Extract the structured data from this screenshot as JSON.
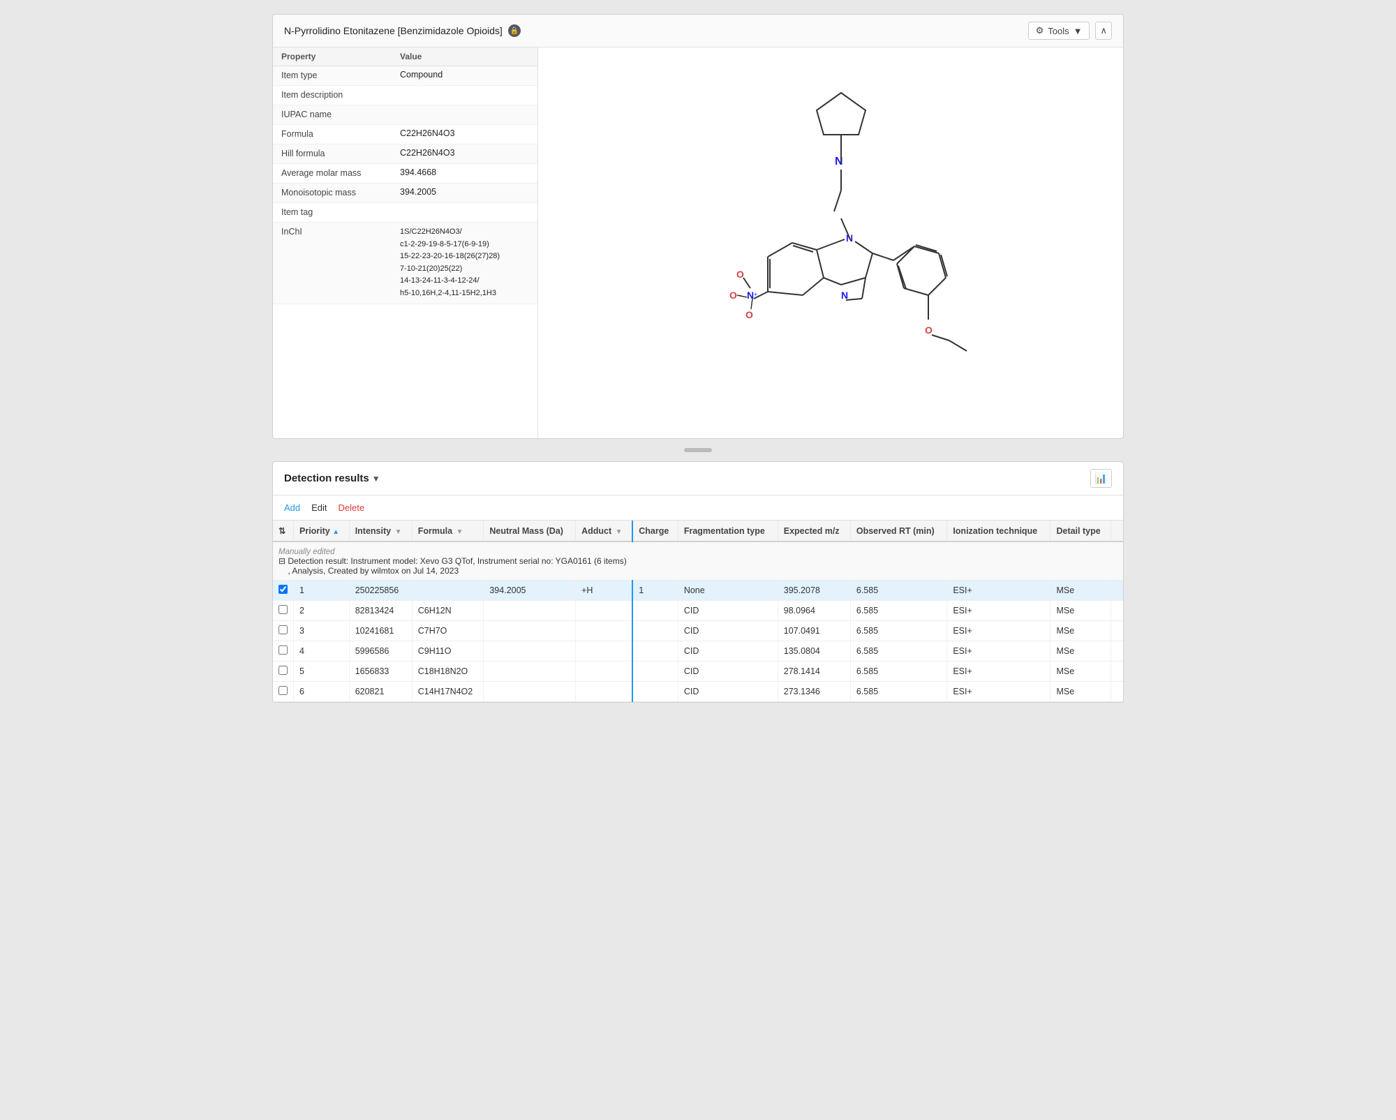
{
  "topPanel": {
    "title": "N-Pyrrolidino Etonitazene  [Benzimidazole Opioids]",
    "toolsLabel": "Tools",
    "properties": [
      {
        "label": "Property",
        "value": "Value",
        "isHeader": true
      },
      {
        "label": "Item type",
        "value": "Compound"
      },
      {
        "label": "Item description",
        "value": ""
      },
      {
        "label": "IUPAC name",
        "value": ""
      },
      {
        "label": "Formula",
        "value": "C22H26N4O3"
      },
      {
        "label": "Hill formula",
        "value": "C22H26N4O3"
      },
      {
        "label": "Average molar mass",
        "value": "394.4668"
      },
      {
        "label": "Monoisotopic mass",
        "value": "394.2005"
      },
      {
        "label": "Item tag",
        "value": ""
      },
      {
        "label": "InChI",
        "value": "1S/C22H26N4O3/\nc1-2-29-19-8-5-17(6-9-19)\n15-22-23-20-16-18(26(27)28)\n7-10-21(20)25(22)\n14-13-24-11-3-4-12-24/\nh5-10,16H,2-4,11-15H2,1H3"
      }
    ]
  },
  "bottomPanel": {
    "title": "Detection results",
    "dropdownArrow": "▼",
    "toolbar": {
      "add": "Add",
      "edit": "Edit",
      "delete": "Delete"
    },
    "tableHeaders": [
      {
        "label": "",
        "key": "cb"
      },
      {
        "label": "Priority",
        "key": "priority",
        "sortable": true,
        "sort": "asc"
      },
      {
        "label": "Intensity",
        "key": "intensity",
        "sortable": true
      },
      {
        "label": "Formula",
        "key": "formula",
        "sortable": true
      },
      {
        "label": "Neutral Mass (Da)",
        "key": "neutralMass",
        "sortable": true
      },
      {
        "label": "Adduct",
        "key": "adduct",
        "sortable": true
      },
      {
        "label": "Charge",
        "key": "charge",
        "sortable": false,
        "divider": true
      },
      {
        "label": "Fragmentation type",
        "key": "fragmentationType",
        "sortable": false
      },
      {
        "label": "Expected m/z",
        "key": "expectedMz",
        "sortable": false
      },
      {
        "label": "Observed RT (min)",
        "key": "observedRT",
        "sortable": false
      },
      {
        "label": "Ionization technique",
        "key": "ionizationTechnique",
        "sortable": false
      },
      {
        "label": "Detail type",
        "key": "detailType",
        "sortable": false
      }
    ],
    "detectionResultLabel": "Detection result: Instrument model: Xevo G3 QTof, Instrument serial no: YGA0161 (6 items)\n, Analysis, Created by wilmtox on Jul 14, 2023",
    "manuallyEditedLabel": "Manually edited",
    "rows": [
      {
        "num": 1,
        "priority": 1,
        "intensity": 250225856,
        "formula": "",
        "neutralMass": "394.2005",
        "adduct": "+H",
        "charge": "1",
        "fragmentationType": "None",
        "expectedMz": "395.2078",
        "observedRT": "6.585",
        "ionizationTechnique": "ESI+",
        "detailType": "MSe",
        "selected": true
      },
      {
        "num": 2,
        "priority": 2,
        "intensity": 82813424,
        "formula": "C6H12N",
        "neutralMass": "",
        "adduct": "",
        "charge": "",
        "fragmentationType": "CID",
        "expectedMz": "98.0964",
        "observedRT": "6.585",
        "ionizationTechnique": "ESI+",
        "detailType": "MSe",
        "selected": false
      },
      {
        "num": 3,
        "priority": 3,
        "intensity": 10241681,
        "formula": "C7H7O",
        "neutralMass": "",
        "adduct": "",
        "charge": "",
        "fragmentationType": "CID",
        "expectedMz": "107.0491",
        "observedRT": "6.585",
        "ionizationTechnique": "ESI+",
        "detailType": "MSe",
        "selected": false
      },
      {
        "num": 4,
        "priority": 4,
        "intensity": 5996586,
        "formula": "C9H11O",
        "neutralMass": "",
        "adduct": "",
        "charge": "",
        "fragmentationType": "CID",
        "expectedMz": "135.0804",
        "observedRT": "6.585",
        "ionizationTechnique": "ESI+",
        "detailType": "MSe",
        "selected": false
      },
      {
        "num": 5,
        "priority": 5,
        "intensity": 1656833,
        "formula": "C18H18N2O",
        "neutralMass": "",
        "adduct": "",
        "charge": "",
        "fragmentationType": "CID",
        "expectedMz": "278.1414",
        "observedRT": "6.585",
        "ionizationTechnique": "ESI+",
        "detailType": "MSe",
        "selected": false
      },
      {
        "num": 6,
        "priority": 6,
        "intensity": 620821,
        "formula": "C14H17N4O2",
        "neutralMass": "",
        "adduct": "",
        "charge": "",
        "fragmentationType": "CID",
        "expectedMz": "273.1346",
        "observedRT": "6.585",
        "ionizationTechnique": "ESI+",
        "detailType": "MSe",
        "selected": false
      }
    ]
  }
}
